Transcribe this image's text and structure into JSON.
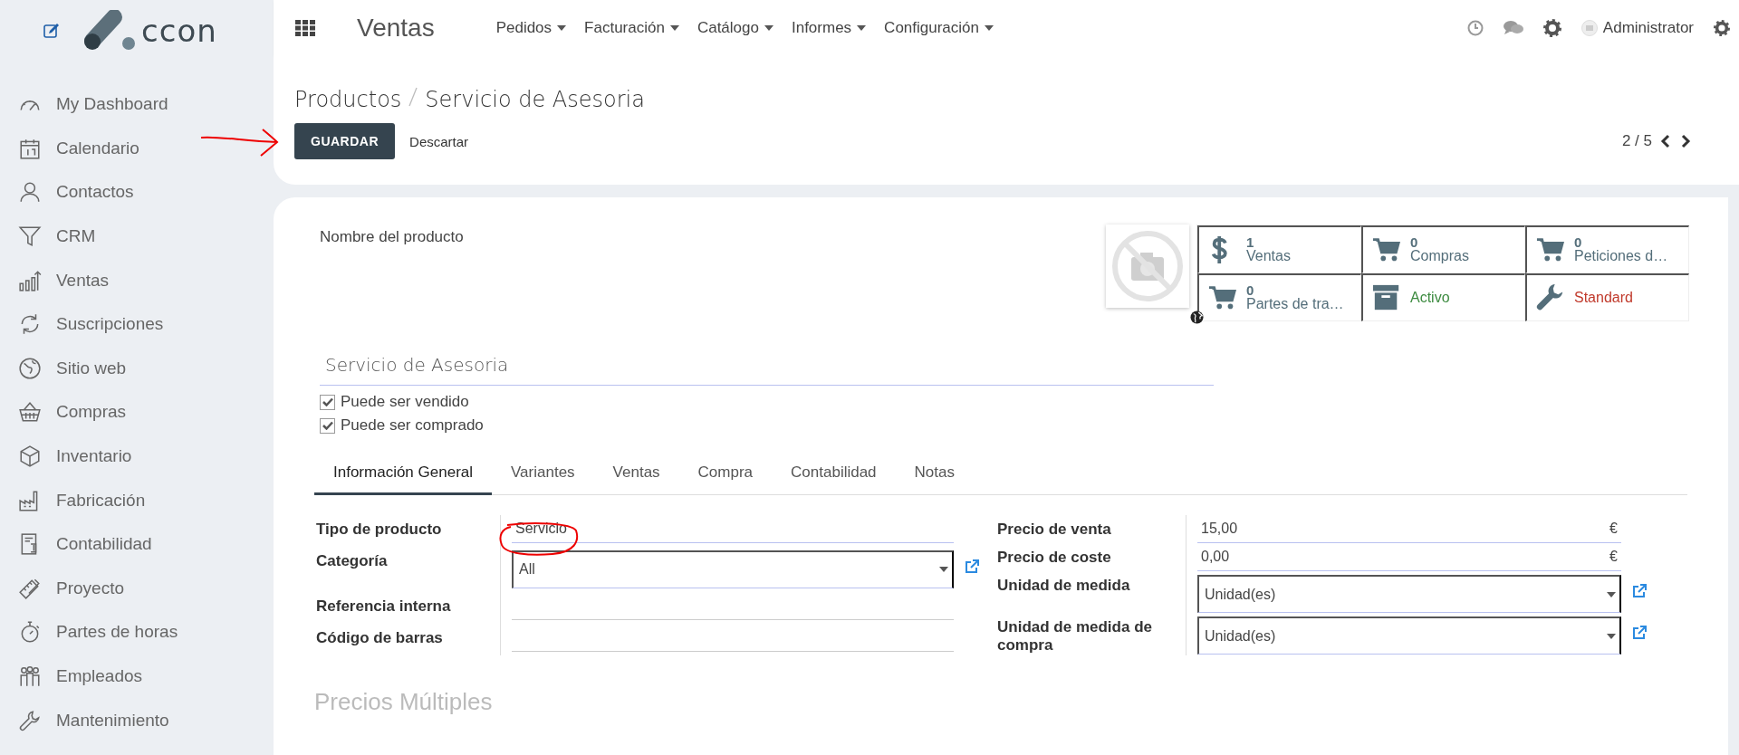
{
  "sidebar": {
    "items": [
      {
        "label": "My Dashboard"
      },
      {
        "label": "Calendario"
      },
      {
        "label": "Contactos"
      },
      {
        "label": "CRM"
      },
      {
        "label": "Ventas"
      },
      {
        "label": "Suscripciones"
      },
      {
        "label": "Sitio web"
      },
      {
        "label": "Compras"
      },
      {
        "label": "Inventario"
      },
      {
        "label": "Fabricación"
      },
      {
        "label": "Contabilidad"
      },
      {
        "label": "Proyecto"
      },
      {
        "label": "Partes de horas"
      },
      {
        "label": "Empleados"
      },
      {
        "label": "Mantenimiento"
      }
    ]
  },
  "logo": {
    "text": "ccon"
  },
  "topbar": {
    "app_title": "Ventas",
    "menus": [
      "Pedidos",
      "Facturación",
      "Catálogo",
      "Informes",
      "Configuración"
    ],
    "user": "Administrator"
  },
  "breadcrumb": [
    "Productos",
    "Servicio de Asesoria"
  ],
  "buttons": {
    "save": "GUARDAR",
    "discard": "Descartar"
  },
  "pager": "2 / 5",
  "form": {
    "name_label": "Nombre del producto",
    "name": "Servicio de Asesoria",
    "stat_buttons": [
      {
        "kind": "counter",
        "count": "1",
        "label": "Ventas"
      },
      {
        "kind": "counter",
        "count": "0",
        "label": "Compras"
      },
      {
        "kind": "counter",
        "count": "0",
        "label": "Peticiones d…"
      },
      {
        "kind": "counter",
        "count": "0",
        "label": "Partes de tra…"
      },
      {
        "kind": "toggle",
        "label": "Activo",
        "color": "#3d8b40"
      },
      {
        "kind": "toggle",
        "label": "Standard",
        "color": "#c0392b"
      }
    ],
    "checkboxes": [
      {
        "label": "Puede ser vendido",
        "checked": true
      },
      {
        "label": "Puede ser comprado",
        "checked": true
      }
    ],
    "tabs": [
      {
        "label": "Información General",
        "selected": true
      },
      {
        "label": "Variantes",
        "selected": false
      },
      {
        "label": "Ventas",
        "selected": false
      },
      {
        "label": "Compra",
        "selected": false
      },
      {
        "label": "Contabilidad",
        "selected": false
      },
      {
        "label": "Notas",
        "selected": false
      }
    ],
    "fields_left": [
      {
        "kind": "text",
        "label": "Tipo de producto",
        "value": "Servicio"
      },
      {
        "kind": "select",
        "label": "Categoría",
        "value": "All",
        "external_link": true
      },
      {
        "kind": "text",
        "label": "Referencia interna"
      },
      {
        "kind": "text",
        "label": "Código de barras"
      }
    ],
    "fields_right": [
      {
        "kind": "monetary",
        "label": "Precio de venta",
        "value": "15,00",
        "currency": "€"
      },
      {
        "kind": "monetary",
        "label": "Precio de coste",
        "value": "0,00",
        "currency": "€"
      },
      {
        "kind": "select",
        "label": "Unidad de medida",
        "value": "Unidad(es)",
        "external_link": true
      },
      {
        "kind": "select",
        "label": "Unidad de medida de compra",
        "value": "Unidad(es)",
        "external_link": true
      }
    ],
    "section_title": "Precios Múltiples"
  }
}
